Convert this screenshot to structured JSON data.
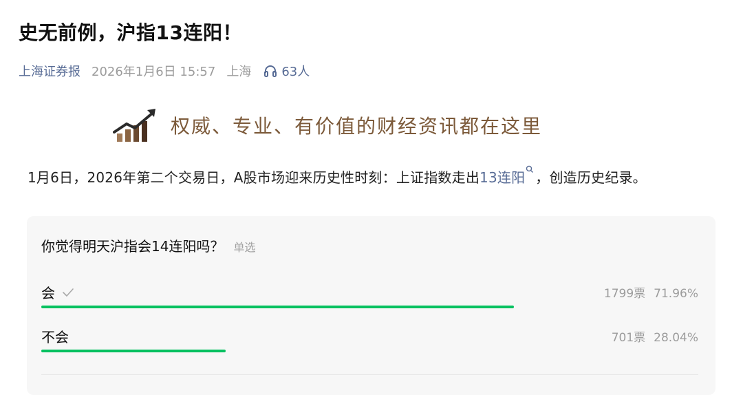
{
  "article": {
    "title": "史无前例，沪指13连阳！",
    "source": "上海证券报",
    "time": "2026年1月6日 15:57",
    "location": "上海",
    "listen_count": "63人"
  },
  "banner": {
    "slogan": "权威、专业、有价值的财经资讯都在这里",
    "logo_icon": "rising-chart-icon"
  },
  "lead": {
    "before": "1月6日，2026年第二个交易日，A股市场迎来历史性时刻：上证指数走出",
    "keyword": "13连阳",
    "after": "，创造历史纪录。"
  },
  "poll": {
    "question": "你觉得明天沪指会14连阳吗？",
    "type": "单选",
    "bar_color": "#07c160",
    "options": [
      {
        "label": "会",
        "votes": "1799票",
        "percent": "71.96%",
        "fraction": 0.7196,
        "selected": true
      },
      {
        "label": "不会",
        "votes": "701票",
        "percent": "28.04%",
        "fraction": 0.2804,
        "selected": false
      }
    ]
  }
}
